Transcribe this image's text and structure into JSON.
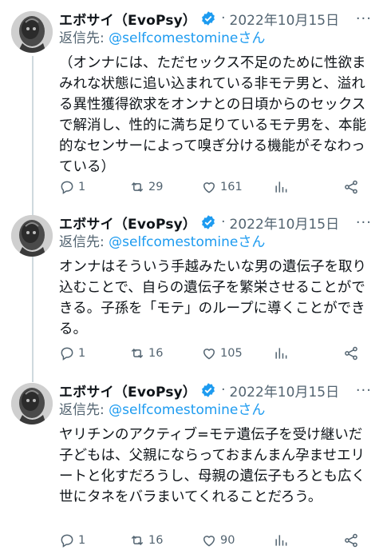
{
  "tweets": [
    {
      "display_name": "エボサイ（EvoPsy）",
      "separator": "·",
      "date": "2022年10月15日",
      "reply_prefix": "返信先: ",
      "reply_handle": "@selfcomestomine",
      "reply_suffix": "さん",
      "text": "（オンナには、ただセックス不足のために性欲まみれな状態に追い込まれている非モテ男と、溢れる異性獲得欲求をオンナとの日頃からのセックスで解消し、性的に満ち足りているモテ男を、本能的なセンサーによって嗅ぎ分ける機能がそなわっている）",
      "replies": "1",
      "retweets": "29",
      "likes": "161"
    },
    {
      "display_name": "エボサイ（EvoPsy）",
      "separator": "·",
      "date": "2022年10月15日",
      "reply_prefix": "返信先: ",
      "reply_handle": "@selfcomestomine",
      "reply_suffix": "さん",
      "text": "オンナはそういう手越みたいな男の遺伝子を取り込むことで、自らの遺伝子を繁栄させることができる。子孫を「モテ」のループに導くことができる。",
      "replies": "1",
      "retweets": "16",
      "likes": "105"
    },
    {
      "display_name": "エボサイ（EvoPsy）",
      "separator": "·",
      "date": "2022年10月15日",
      "reply_prefix": "返信先: ",
      "reply_handle": "@selfcomestomine",
      "reply_suffix": "さん",
      "text": "ヤリチンのアクティブ=モテ遺伝子を受け継いだ子どもは、父親にならっておまんまん孕ませエリートと化すだろうし、母親の遺伝子もろとも広く世にタネをバラまいてくれることだろう。",
      "replies": "1",
      "retweets": "16",
      "likes": "90"
    }
  ],
  "icons": {
    "verified": "verified-badge-icon",
    "more": "more-icon",
    "reply": "reply-icon",
    "retweet": "retweet-icon",
    "like": "heart-icon",
    "stats": "stats-icon",
    "share": "share-icon"
  },
  "colors": {
    "accent": "#1d9bf0",
    "secondary_text": "#536471",
    "text": "#0f1419",
    "thread_line": "#cfd9de"
  }
}
